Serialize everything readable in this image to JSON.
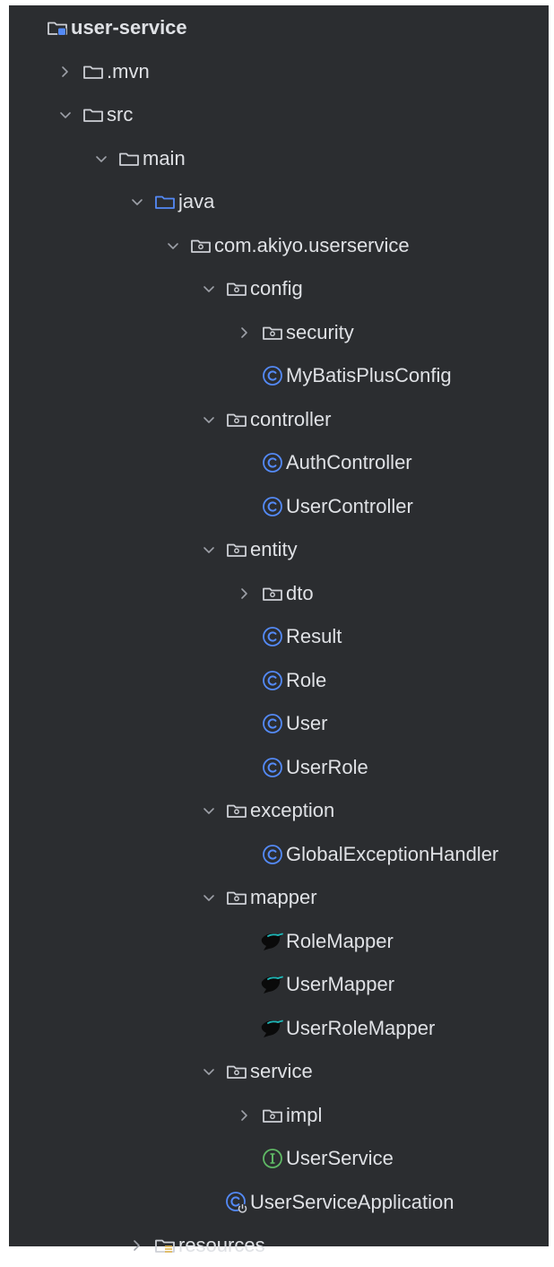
{
  "project_tree": {
    "items": [
      {
        "label": "user-service",
        "depth": 0,
        "icon": "module-folder-icon",
        "expand": "none",
        "bold": true
      },
      {
        "label": ".mvn",
        "depth": 1,
        "icon": "folder-icon",
        "expand": "collapsed"
      },
      {
        "label": "src",
        "depth": 1,
        "icon": "folder-icon",
        "expand": "expanded"
      },
      {
        "label": "main",
        "depth": 2,
        "icon": "folder-icon",
        "expand": "expanded"
      },
      {
        "label": "java",
        "depth": 3,
        "icon": "source-root-icon",
        "expand": "expanded"
      },
      {
        "label": "com.akiyo.userservice",
        "depth": 4,
        "icon": "package-icon",
        "expand": "expanded"
      },
      {
        "label": "config",
        "depth": 5,
        "icon": "package-icon",
        "expand": "expanded"
      },
      {
        "label": "security",
        "depth": 6,
        "icon": "package-icon",
        "expand": "collapsed"
      },
      {
        "label": "MyBatisPlusConfig",
        "depth": 6,
        "icon": "class-icon",
        "expand": "none"
      },
      {
        "label": "controller",
        "depth": 5,
        "icon": "package-icon",
        "expand": "expanded"
      },
      {
        "label": "AuthController",
        "depth": 6,
        "icon": "class-icon",
        "expand": "none"
      },
      {
        "label": "UserController",
        "depth": 6,
        "icon": "class-icon",
        "expand": "none"
      },
      {
        "label": "entity",
        "depth": 5,
        "icon": "package-icon",
        "expand": "expanded"
      },
      {
        "label": "dto",
        "depth": 6,
        "icon": "package-icon",
        "expand": "collapsed"
      },
      {
        "label": "Result",
        "depth": 6,
        "icon": "class-icon",
        "expand": "none"
      },
      {
        "label": "Role",
        "depth": 6,
        "icon": "class-icon",
        "expand": "none"
      },
      {
        "label": "User",
        "depth": 6,
        "icon": "class-icon",
        "expand": "none"
      },
      {
        "label": "UserRole",
        "depth": 6,
        "icon": "class-icon",
        "expand": "none"
      },
      {
        "label": "exception",
        "depth": 5,
        "icon": "package-icon",
        "expand": "expanded"
      },
      {
        "label": "GlobalExceptionHandler",
        "depth": 6,
        "icon": "class-icon",
        "expand": "none"
      },
      {
        "label": "mapper",
        "depth": 5,
        "icon": "package-icon",
        "expand": "expanded"
      },
      {
        "label": "RoleMapper",
        "depth": 6,
        "icon": "mybatis-mapper-icon",
        "expand": "none"
      },
      {
        "label": "UserMapper",
        "depth": 6,
        "icon": "mybatis-mapper-icon",
        "expand": "none"
      },
      {
        "label": "UserRoleMapper",
        "depth": 6,
        "icon": "mybatis-mapper-icon",
        "expand": "none"
      },
      {
        "label": "service",
        "depth": 5,
        "icon": "package-icon",
        "expand": "expanded"
      },
      {
        "label": "impl",
        "depth": 6,
        "icon": "package-icon",
        "expand": "collapsed"
      },
      {
        "label": "UserService",
        "depth": 6,
        "icon": "interface-icon",
        "expand": "none"
      },
      {
        "label": "UserServiceApplication",
        "depth": 5,
        "icon": "spring-boot-application-icon",
        "expand": "none"
      },
      {
        "label": "resources",
        "depth": 3,
        "icon": "resources-root-icon",
        "expand": "collapsed"
      }
    ]
  },
  "colors": {
    "panel_background": "#2b2d30",
    "text": "#dfe1e5",
    "chevron": "#9da0a8",
    "folder_outline": "#ced0d6",
    "source_root": "#548af7",
    "class_icon": "#548af7",
    "interface_icon": "#5fb865",
    "mapper_teal": "#1fb8b8"
  }
}
